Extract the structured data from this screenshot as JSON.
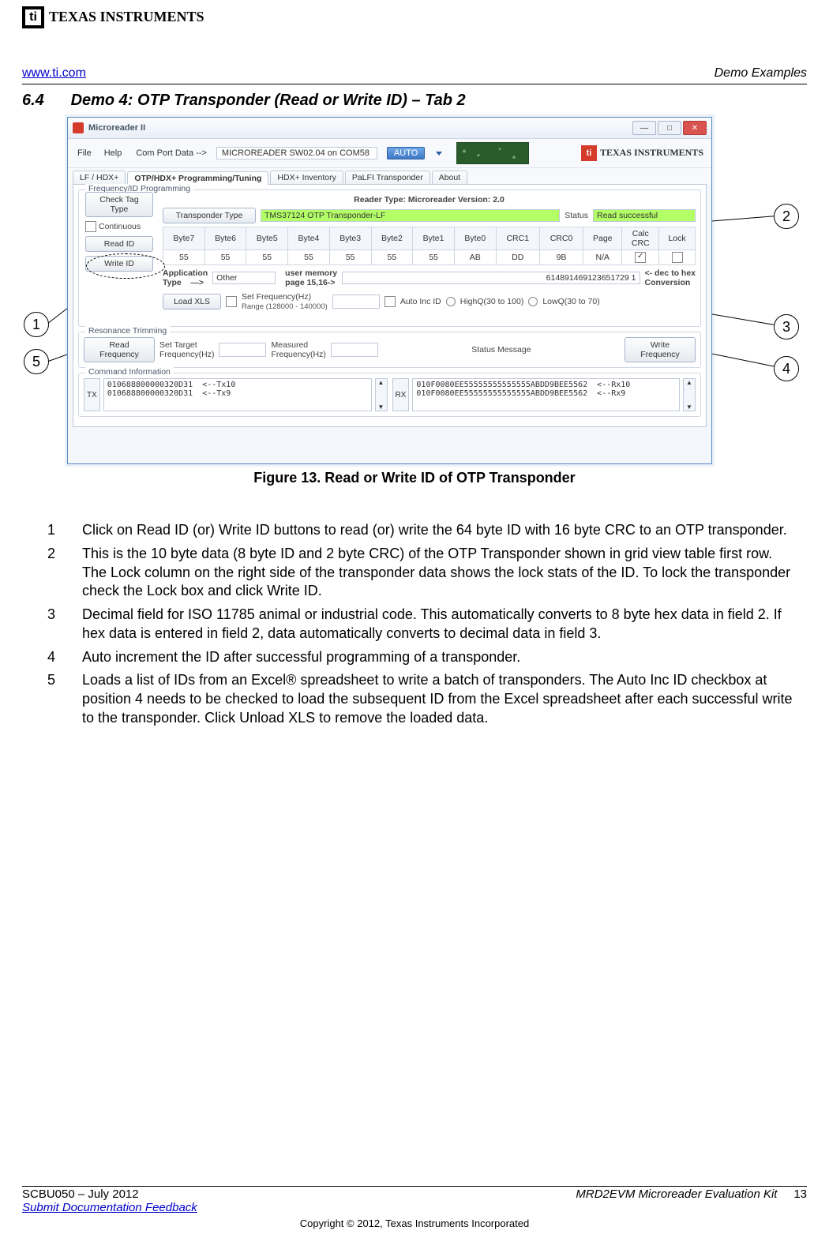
{
  "logo": {
    "brand": "TEXAS INSTRUMENTS"
  },
  "header": {
    "url": "www.ti.com",
    "section": "Demo Examples"
  },
  "section": {
    "number": "6.4",
    "title": "Demo 4: OTP Transponder (Read or Write ID) – Tab 2"
  },
  "win": {
    "title": "Microreader II",
    "menu": {
      "file": "File",
      "help": "Help",
      "comport_label": "Com Port Data -->",
      "comport_value": "MICROREADER SW02.04 on COM58",
      "auto": "AUTO",
      "brand": "TEXAS INSTRUMENTS"
    },
    "tabs": {
      "t0": "LF / HDX+",
      "t1": "OTP/HDX+ Programming/Tuning",
      "t2": "HDX+ Inventory",
      "t3": "PaLFI Transponder",
      "t4": "About"
    },
    "freq": {
      "legend": "Frequency/ID Programming",
      "reader_type": "Reader Type: Microreader   Version: 2.0",
      "transponder_label": "Transponder Type",
      "transponder_value": "TMS37124 OTP Transponder-LF",
      "status_label": "Status",
      "status_value": "Read successful",
      "btn_check": "Check Tag\nType",
      "btn_continuous": "Continuous",
      "btn_read": "Read ID",
      "btn_write": "Write ID",
      "cols": [
        "Byte7",
        "Byte6",
        "Byte5",
        "Byte4",
        "Byte3",
        "Byte2",
        "Byte1",
        "Byte0",
        "CRC1",
        "CRC0",
        "Page",
        "Calc\nCRC",
        "Lock"
      ],
      "vals": [
        "55",
        "55",
        "55",
        "55",
        "55",
        "55",
        "55",
        "AB",
        "DD",
        "9B",
        "N/A",
        "✓",
        ""
      ],
      "apptype_label": "Application\nType    —>",
      "apptype_value": "Other",
      "usermem_label": "user memory\npage 15,16->",
      "dec_value": "614891469123651729 1",
      "dec_hex_label": "<- dec to hex\nConversion",
      "loadxls": "Load XLS",
      "setfreq_label": "Set Frequency(Hz)",
      "setfreq_range": "Range (128000 - 140000)",
      "autoinc": "Auto Inc ID",
      "highq": "HighQ(30 to 100)",
      "lowq": "LowQ(30 to 70)"
    },
    "res": {
      "legend": "Resonance Trimming",
      "read": "Read\nFrequency",
      "set_target": "Set Target\nFrequency(Hz)",
      "measured": "Measured\nFrequency(Hz)",
      "status": "Status Message",
      "write": "Write\nFrequency"
    },
    "cmd": {
      "legend": "Command Information",
      "tx": "TX",
      "rx": "RX",
      "tx_lines": "010688800000320D31  <--Tx10\n010688800000320D31  <--Tx9",
      "rx_lines": "010F0080EE55555555555555ABDD9BEE5562  <--Rx10\n010F0080EE55555555555555ABDD9BEE5562  <--Rx9"
    }
  },
  "callouts": {
    "c1": "1",
    "c2": "2",
    "c3": "3",
    "c4": "4",
    "c5": "5"
  },
  "figure_caption": "Figure 13. Read or Write ID of OTP Transponder",
  "desc": {
    "n1": "1",
    "t1": "Click on Read ID (or) Write ID buttons to read (or) write the 64 byte ID with 16 byte CRC to an OTP transponder.",
    "n2": "2",
    "t2": "This is the 10 byte data (8 byte ID and 2 byte CRC) of the OTP Transponder shown in grid view table first row. The Lock column on the right side of the transponder data shows the lock stats of the ID. To lock the transponder check the Lock box and click Write ID.",
    "n3": "3",
    "t3": "Decimal field for ISO 11785 animal or industrial code. This automatically converts to 8 byte hex data in field 2. If hex data is entered in field 2, data automatically converts to decimal data in field 3.",
    "n4": "4",
    "t4": "Auto increment the ID after successful programming of a transponder.",
    "n5": "5",
    "t5": "Loads a list of IDs from an Excel® spreadsheet to write a batch of transponders. The Auto Inc ID checkbox at position 4 needs to be checked to load the subsequent ID from the Excel spreadsheet after each successful write to the transponder. Click Unload XLS to remove the loaded data."
  },
  "footer": {
    "docnum": "SCBU050 – July 2012",
    "feedback": "Submit Documentation Feedback",
    "title": "MRD2EVM Microreader Evaluation Kit",
    "page": "13",
    "copyright": "Copyright © 2012, Texas Instruments Incorporated"
  }
}
